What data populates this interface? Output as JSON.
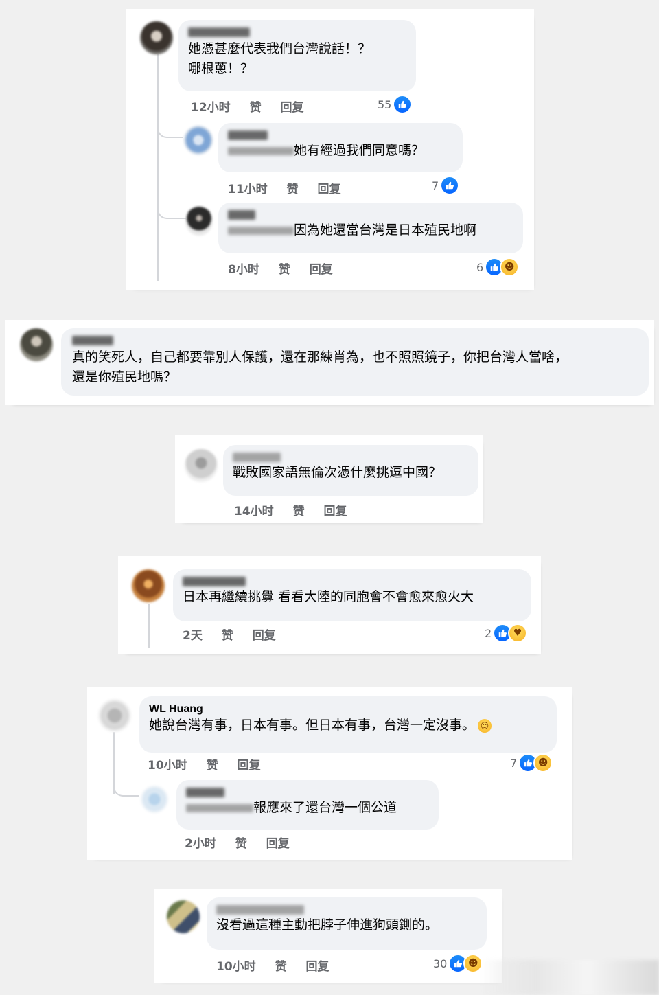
{
  "colors": {
    "like_blue": "#0866ff",
    "bubble_bg": "#f0f2f5",
    "meta_gray": "#65676b",
    "page_bg": "#f0f0f0"
  },
  "card1": {
    "main": {
      "text_lines": [
        "她憑甚麼代表我們台灣說話！？",
        "哪根蔥！？"
      ],
      "time": "12小时",
      "like": "赞",
      "reply": "回复",
      "reaction_count": "55"
    },
    "reply1": {
      "text": "她有經過我們同意嗎？",
      "time": "11小时",
      "like": "赞",
      "reply": "回复",
      "reaction_count": "7"
    },
    "reply2": {
      "text": "因為她還當台灣是日本殖民地啊",
      "time": "8小时",
      "like": "赞",
      "reply": "回复",
      "reaction_count": "6"
    }
  },
  "card2": {
    "text_lines": [
      "真的笑死人，自己都要靠別人保護，還在那練肖為，也不照照鏡子，你把台灣人當啥，",
      "還是你殖民地嗎？"
    ]
  },
  "card3": {
    "text": "戰敗國家語無倫次憑什麼挑逗中國？",
    "time": "14小时",
    "like": "赞",
    "reply": "回复"
  },
  "card4": {
    "text": "日本再繼續挑釁 看看大陸的同胞會不會愈來愈火大",
    "time": "2天",
    "like": "赞",
    "reply": "回复",
    "reaction_count": "2"
  },
  "card5": {
    "main": {
      "name": "WL Huang",
      "text": "她說台灣有事，日本有事。但日本有事，台灣一定沒事。",
      "time": "10小时",
      "like": "赞",
      "reply": "回复",
      "reaction_count": "7"
    },
    "reply1": {
      "text": "報應來了還台灣一個公道",
      "time": "2小时",
      "like": "赞",
      "reply": "回复"
    }
  },
  "card6": {
    "text": "沒看過這種主動把脖子伸進狗頭鍘的。",
    "time": "10小时",
    "like": "赞",
    "reply": "回复",
    "reaction_count": "30"
  }
}
